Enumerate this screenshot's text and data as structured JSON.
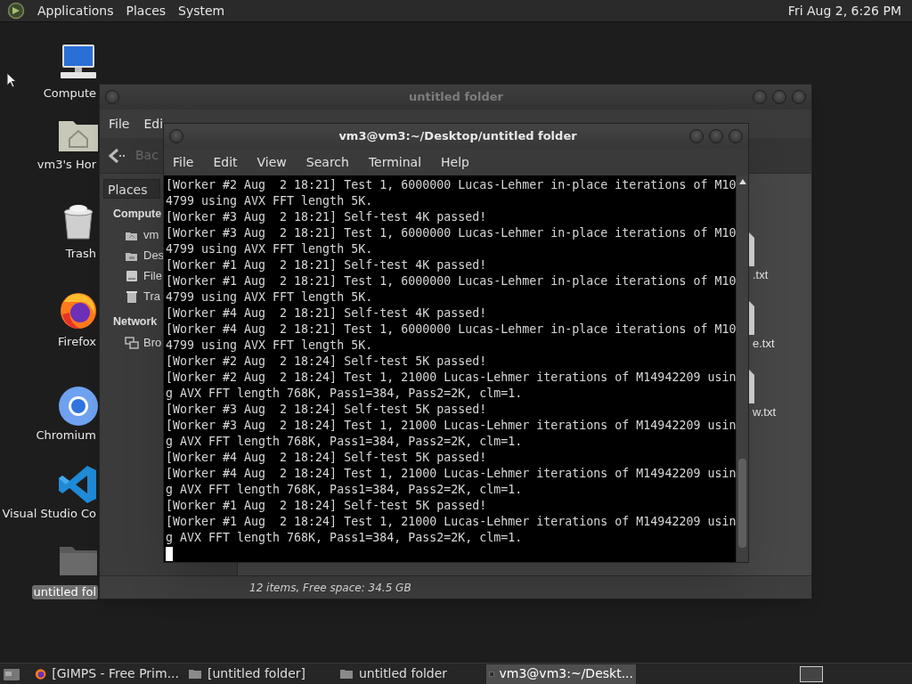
{
  "top_panel": {
    "menus": [
      "Applications",
      "Places",
      "System"
    ],
    "clock": "Fri Aug 2, 6:26 PM"
  },
  "desktop_icons": [
    {
      "label": "Compute",
      "kind": "computer",
      "selected": false
    },
    {
      "label": "vm3's Hor",
      "kind": "home",
      "selected": false
    },
    {
      "label": "Trash",
      "kind": "trash",
      "selected": false
    },
    {
      "label": "Firefox",
      "kind": "firefox",
      "selected": false
    },
    {
      "label": "Chromium",
      "kind": "chromium",
      "selected": false
    },
    {
      "label": "Visual Studio Co",
      "kind": "vscode",
      "selected": false
    },
    {
      "label": "untitled fol",
      "kind": "folder",
      "selected": true
    }
  ],
  "file_manager": {
    "title": "untitled folder",
    "menus": [
      "File",
      "Edi"
    ],
    "back": "Bac",
    "places_dropdown": "Places",
    "sidebar": [
      {
        "label": "Compute",
        "kind": "header"
      },
      {
        "label": "vm",
        "kind": "home"
      },
      {
        "label": "Des",
        "kind": "desktop"
      },
      {
        "label": "File",
        "kind": "drive"
      },
      {
        "label": "Tra",
        "kind": "trash"
      },
      {
        "label": "Network",
        "kind": "header"
      },
      {
        "label": "Bro",
        "kind": "network"
      }
    ],
    "files": [
      ".txt",
      "e.txt",
      "w.txt"
    ],
    "status_bar": "12 items, Free space: 34.5 GB"
  },
  "terminal": {
    "title": "vm3@vm3:~/Desktop/untitled folder",
    "menus": [
      "File",
      "Edit",
      "View",
      "Search",
      "Terminal",
      "Help"
    ],
    "lines": [
      "[Worker #2 Aug  2 18:21] Test 1, 6000000 Lucas-Lehmer in-place iterations of M10",
      "4799 using AVX FFT length 5K.",
      "[Worker #3 Aug  2 18:21] Self-test 4K passed!",
      "[Worker #3 Aug  2 18:21] Test 1, 6000000 Lucas-Lehmer in-place iterations of M10",
      "4799 using AVX FFT length 5K.",
      "[Worker #1 Aug  2 18:21] Self-test 4K passed!",
      "[Worker #1 Aug  2 18:21] Test 1, 6000000 Lucas-Lehmer in-place iterations of M10",
      "4799 using AVX FFT length 5K.",
      "[Worker #4 Aug  2 18:21] Self-test 4K passed!",
      "[Worker #4 Aug  2 18:21] Test 1, 6000000 Lucas-Lehmer in-place iterations of M10",
      "4799 using AVX FFT length 5K.",
      "[Worker #2 Aug  2 18:24] Self-test 5K passed!",
      "[Worker #2 Aug  2 18:24] Test 1, 21000 Lucas-Lehmer iterations of M14942209 usin",
      "g AVX FFT length 768K, Pass1=384, Pass2=2K, clm=1.",
      "[Worker #3 Aug  2 18:24] Self-test 5K passed!",
      "[Worker #3 Aug  2 18:24] Test 1, 21000 Lucas-Lehmer iterations of M14942209 usin",
      "g AVX FFT length 768K, Pass1=384, Pass2=2K, clm=1.",
      "[Worker #4 Aug  2 18:24] Self-test 5K passed!",
      "[Worker #4 Aug  2 18:24] Test 1, 21000 Lucas-Lehmer iterations of M14942209 usin",
      "g AVX FFT length 768K, Pass1=384, Pass2=2K, clm=1.",
      "[Worker #1 Aug  2 18:24] Self-test 5K passed!",
      "[Worker #1 Aug  2 18:24] Test 1, 21000 Lucas-Lehmer iterations of M14942209 usin",
      "g AVX FFT length 768K, Pass1=384, Pass2=2K, clm=1."
    ]
  },
  "taskbar": {
    "items": [
      {
        "label": "[GIMPS - Free Prim...",
        "kind": "browser",
        "selected": false
      },
      {
        "label": "[untitled folder]",
        "kind": "folder",
        "selected": false
      },
      {
        "label": "untitled folder",
        "kind": "folder",
        "selected": false
      },
      {
        "label": "vm3@vm3:~/Deskt...",
        "kind": "terminal",
        "selected": true
      }
    ]
  }
}
